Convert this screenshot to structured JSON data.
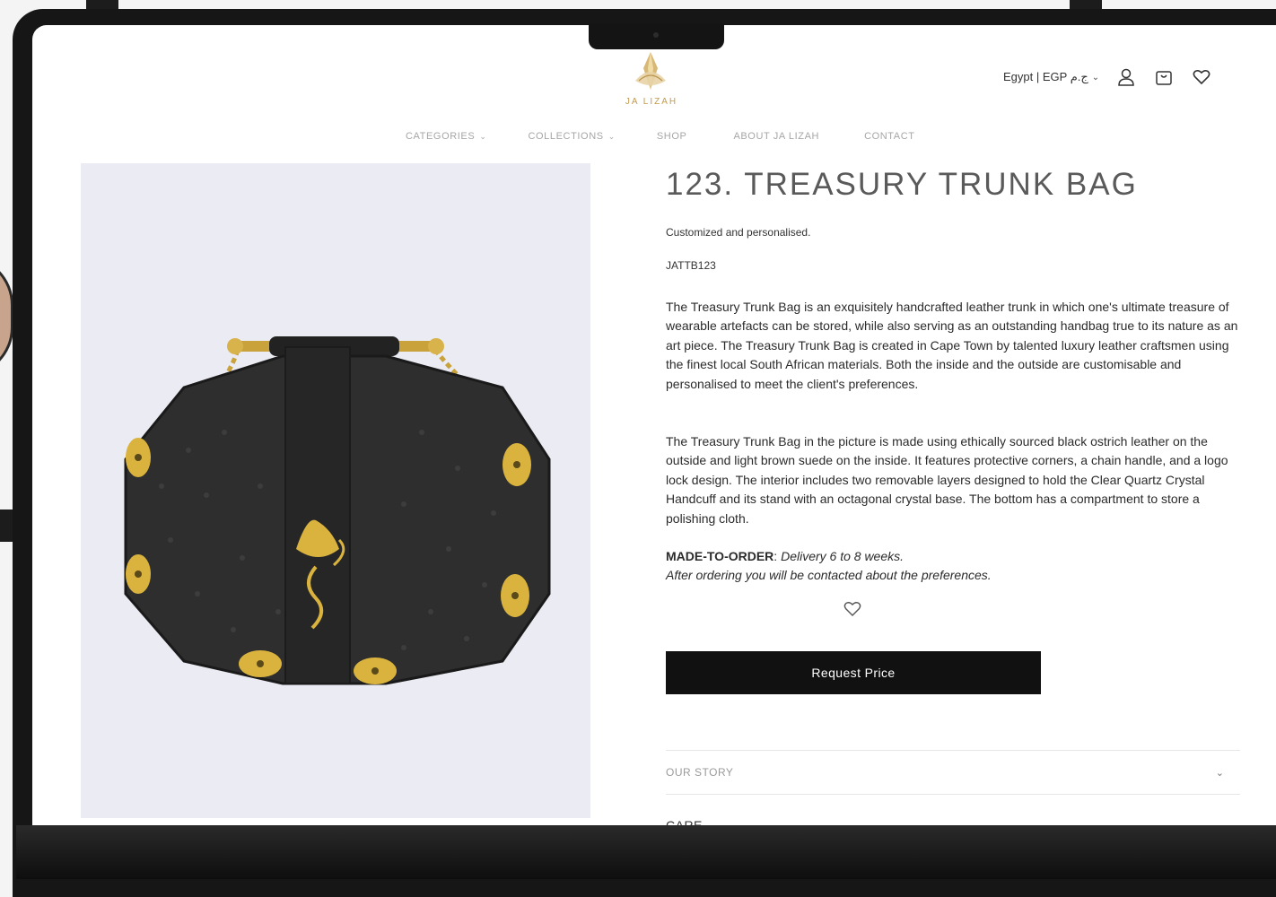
{
  "header": {
    "brand_name": "JA LIZAH",
    "locale_label": "Egypt | EGP ج.م",
    "icons": [
      "account-icon",
      "cart-icon",
      "wishlist-icon"
    ]
  },
  "nav": {
    "items": [
      {
        "label": "CATEGORIES",
        "dropdown": true
      },
      {
        "label": "COLLECTIONS",
        "dropdown": true
      },
      {
        "label": "SHOP",
        "dropdown": false
      },
      {
        "label": "ABOUT JA LIZAH",
        "dropdown": false
      },
      {
        "label": "CONTACT",
        "dropdown": false
      }
    ]
  },
  "product": {
    "title": "123. TREASURY TRUNK BAG",
    "subtitle": "Customized and personalised.",
    "sku": "JATTB123",
    "description_1": "The Treasury Trunk Bag is an exquisitely handcrafted leather trunk in which one's ultimate treasure of wearable artefacts can be stored, while also serving as an outstanding handbag true to its nature as an art piece. The Treasury Trunk Bag is created in Cape Town by talented luxury leather craftsmen using the finest local South African materials. Both the inside and the outside are customisable and personalised to meet the client's preferences.",
    "description_2": "The Treasury Trunk Bag in the picture is made using ethically sourced black ostrich leather on the outside and light brown suede on the inside. It features protective corners, a chain handle, and a logo lock design. The interior includes two removable layers designed to hold the Clear Quartz Crystal Handcuff and its stand with an octagonal crystal base. The bottom has a compartment to store a polishing cloth.",
    "made_to_order_label": "MADE-TO-ORDER",
    "made_to_order_text": "Delivery 6 to 8 weeks.",
    "made_to_order_note": "After ordering you will be contacted about the preferences.",
    "request_button": "Request Price"
  },
  "accordion": {
    "items": [
      {
        "label": "OUR STORY"
      }
    ],
    "care_label": "CARE"
  },
  "colors": {
    "accent_gold": "#c29a4d",
    "button_bg": "#111111",
    "image_bg": "#ebebf3"
  }
}
